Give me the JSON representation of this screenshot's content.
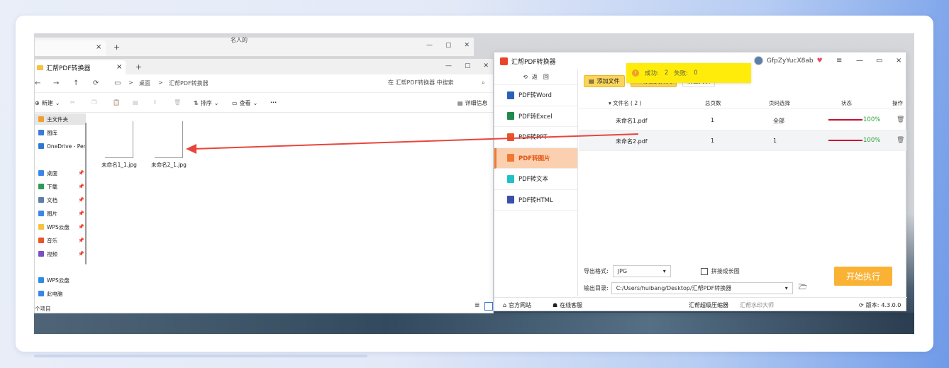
{
  "background_window": {
    "top_text": "名人的",
    "new_tab": "+",
    "close": "×"
  },
  "explorer": {
    "tab_title": "汇帮PDF转换器",
    "tab_close": "×",
    "new_tab": "+",
    "nav": {
      "back": "←",
      "forward": "→",
      "up": "↑",
      "refresh": "⟳",
      "display": "▭",
      "sep": ">"
    },
    "breadcrumb": [
      "桌面",
      "汇帮PDF转换器"
    ],
    "search_placeholder": "在 汇帮PDF转换器 中搜索",
    "commands": {
      "new": "新建",
      "sort": "排序",
      "view": "查看",
      "more": "···",
      "details": "详细信息"
    },
    "sidebar": [
      {
        "label": "主文件夹",
        "color": "#f0a030",
        "pinned": false,
        "selected": true
      },
      {
        "label": "图库",
        "color": "#3a7bd5",
        "pinned": false
      },
      {
        "label": "OneDrive - Per",
        "color": "#2b78d6",
        "pinned": false
      },
      {
        "label": "桌面",
        "color": "#3a86e8",
        "pinned": true
      },
      {
        "label": "下载",
        "color": "#2b9a5a",
        "pinned": true
      },
      {
        "label": "文档",
        "color": "#5b7fa6",
        "pinned": true
      },
      {
        "label": "图片",
        "color": "#3a86e8",
        "pinned": true
      },
      {
        "label": "WPS云盘",
        "color": "#f5c242",
        "pinned": true
      },
      {
        "label": "音乐",
        "color": "#e8552b",
        "pinned": true
      },
      {
        "label": "视频",
        "color": "#7a4fc2",
        "pinned": true
      },
      {
        "label": "WPS云盘",
        "color": "#2b8ce8",
        "pinned": false
      },
      {
        "label": "此电脑",
        "color": "#3a86e8",
        "pinned": false
      }
    ],
    "pin_glyph": "📌",
    "files": [
      "未命名1_1.jpg",
      "未命名2_1.jpg"
    ],
    "status": "个项目"
  },
  "app": {
    "title": "汇帮PDF转换器",
    "username": "GfpZyYucX8ab",
    "vip_glyph": "♥",
    "window_ctrls": [
      "≡",
      "—",
      "▭",
      "×"
    ],
    "back_label": "返　回",
    "menu": [
      {
        "label": "PDF转Word",
        "color": "#2b5fb8",
        "active": false
      },
      {
        "label": "PDF转Excel",
        "color": "#1f8a4c",
        "active": false
      },
      {
        "label": "PDF转PPT",
        "color": "#e8552b",
        "active": false
      },
      {
        "label": "PDF转图片",
        "color": "#f07830",
        "active": true
      },
      {
        "label": "PDF转文本",
        "color": "#20c0c8",
        "active": false
      },
      {
        "label": "PDF转HTML",
        "color": "#3a4fa8",
        "active": false
      }
    ],
    "toolbar": {
      "add_file": "添加文件",
      "add_folder": "添加文件夹",
      "clear": "清空列表"
    },
    "toast": {
      "success_label": "成功:",
      "success_count": "2",
      "fail_label": "失败:",
      "fail_count": "0"
    },
    "table": {
      "headers": {
        "name": "▾ 文件名 ( 2 )",
        "pages": "总页数",
        "range": "页码选择",
        "status": "状态",
        "action": "操作"
      },
      "rows": [
        {
          "name": "未命名1.pdf",
          "pages": "1",
          "range": "全部",
          "progress_pct": 100,
          "status": "100%"
        },
        {
          "name": "未命名2.pdf",
          "pages": "1",
          "range": "1",
          "progress_pct": 100,
          "status": "100%"
        }
      ]
    },
    "output": {
      "format_label": "导出格式:",
      "format_value": "JPG",
      "stitch_label": "拼接成长图",
      "dir_label": "输出目录:",
      "dir_value": "C:/Users/huibang/Desktop/汇帮PDF转换器"
    },
    "start_label": "开始执行",
    "footer": {
      "website": "官方网站",
      "service": "在线客服",
      "compressor": "汇帮超级压缩器",
      "watermark": "汇帮水印大师",
      "version_label": "版本:",
      "version": "4.3.0.0"
    }
  }
}
